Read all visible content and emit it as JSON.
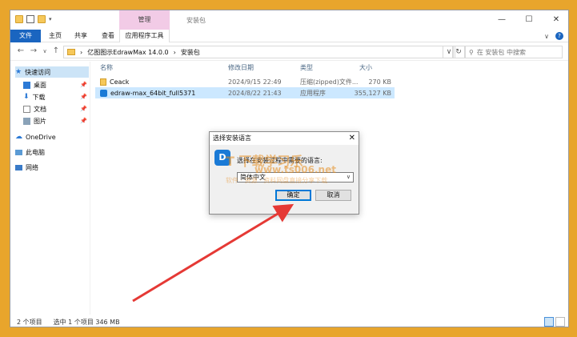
{
  "window": {
    "context_tab": "管理",
    "title": "安装包",
    "min": "—",
    "max": "☐",
    "close": "✕"
  },
  "ribbon": {
    "tabs": [
      "文件",
      "主页",
      "共享",
      "查看",
      "应用程序工具"
    ],
    "chevron": "∨",
    "help": "?"
  },
  "address": {
    "crumbs": [
      "亿图图示EdrawMax 14.0.0",
      "安装包"
    ],
    "separator": "›",
    "search_placeholder": "在 安装包 中搜索"
  },
  "nav": {
    "items": [
      {
        "label": "快速访问",
        "icon": "star-icon",
        "color": "#2c7ad6"
      },
      {
        "label": "桌面",
        "icon": "desktop-icon",
        "color": "#2c7ad6"
      },
      {
        "label": "下载",
        "icon": "download-icon",
        "color": "#2c7ad6"
      },
      {
        "label": "文档",
        "icon": "document-icon",
        "color": "#888888"
      },
      {
        "label": "图片",
        "icon": "pictures-icon",
        "color": "#888888"
      },
      {
        "label": "OneDrive",
        "icon": "cloud-icon",
        "color": "#2c7ad6"
      },
      {
        "label": "此电脑",
        "icon": "computer-icon",
        "color": "#2c7ad6"
      },
      {
        "label": "网络",
        "icon": "network-icon",
        "color": "#2c7ad6"
      }
    ]
  },
  "list": {
    "headers": [
      "名称",
      "修改日期",
      "类型",
      "大小"
    ],
    "rows": [
      {
        "name": "Ceack",
        "date": "2024/9/15 22:49",
        "type": "压缩(zipped)文件...",
        "size": "270 KB",
        "icon": "zip-folder-icon"
      },
      {
        "name": "edraw-max_64bit_full5371",
        "date": "2024/8/22 21:43",
        "type": "应用程序",
        "size": "355,127 KB",
        "icon": "app-icon"
      }
    ]
  },
  "status": {
    "count": "2 个项目",
    "selected": "选中 1 个项目  346 MB"
  },
  "dialog": {
    "title": "选择安装语言",
    "close": "✕",
    "icon_text": "D",
    "message": "选择在安装过程中需要的语言:",
    "selected_language": "简体中文",
    "ok": "确定",
    "cancel": "取消"
  },
  "watermark": {
    "line1": "T 下载学习乐",
    "line2": "www.ts006.net",
    "line3": "软件 · 资源 · 资料网盘直接分享下载"
  },
  "colors": {
    "accent": "#1a65c0",
    "arrow": "#e53935",
    "background": "#e8a52c"
  }
}
